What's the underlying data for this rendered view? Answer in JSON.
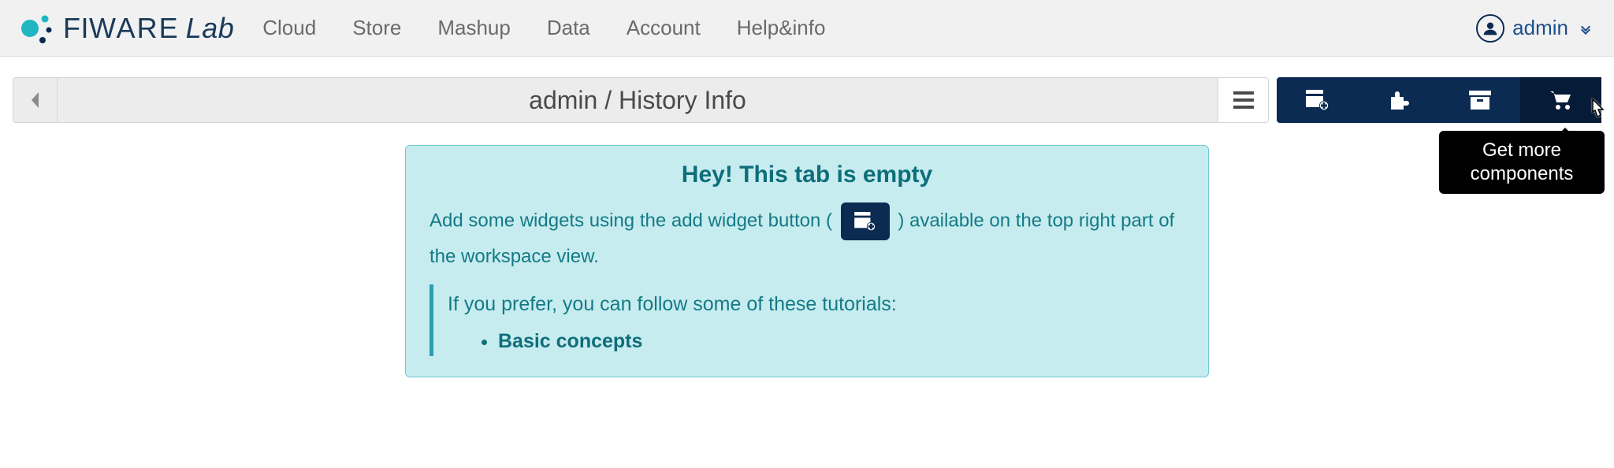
{
  "brand": {
    "fi": "FI",
    "ware": "WARE",
    "lab": "Lab"
  },
  "nav": {
    "items": [
      "Cloud",
      "Store",
      "Mashup",
      "Data",
      "Account",
      "Help&info"
    ]
  },
  "user": {
    "name": "admin"
  },
  "workspace": {
    "title": "admin / History Info"
  },
  "actions": {
    "tooltip": "Get more components"
  },
  "notice": {
    "heading": "Hey! This tab is empty",
    "body_before": "Add some widgets using the add widget button ( ",
    "body_after": " ) available on the top right part of the workspace view.",
    "tutorials_intro": "If you prefer, you can follow some of these tutorials:",
    "tutorials": [
      "Basic concepts"
    ]
  }
}
